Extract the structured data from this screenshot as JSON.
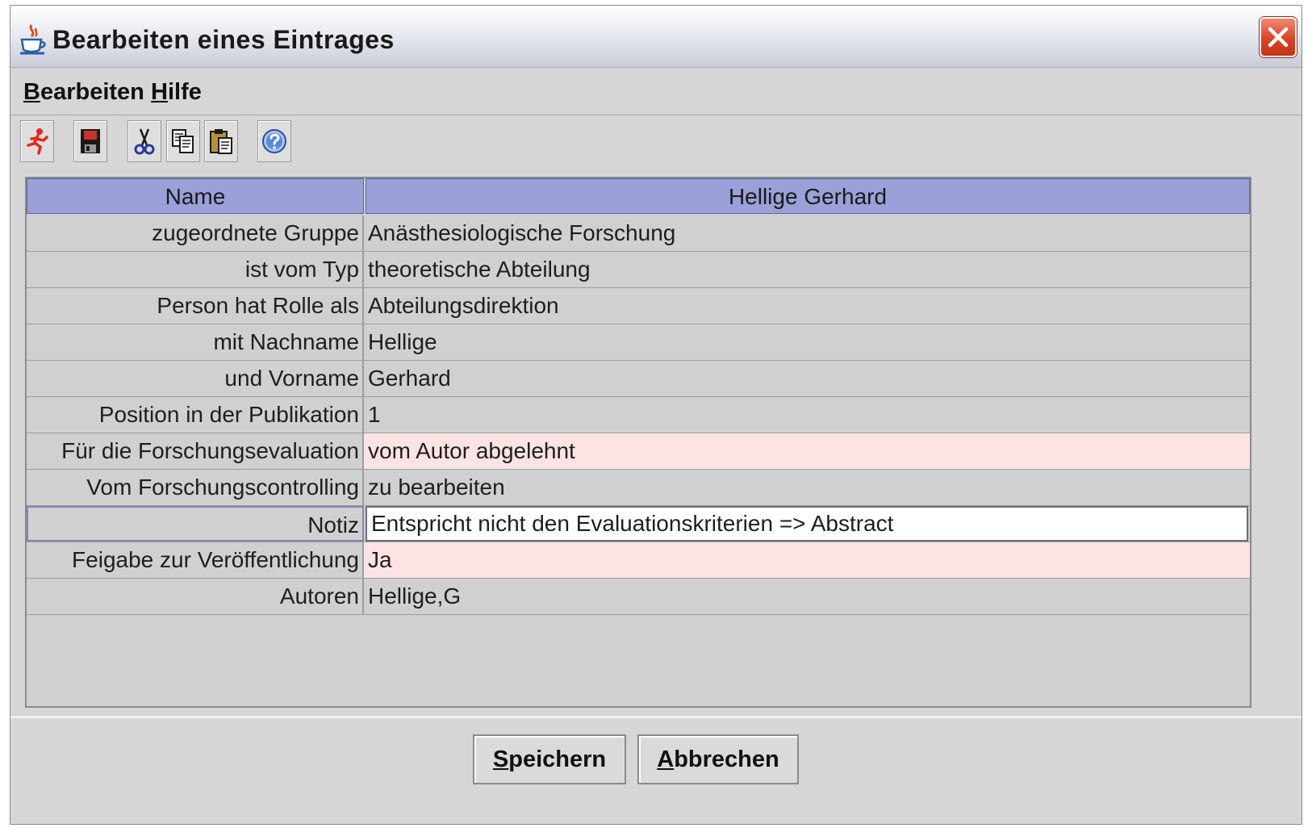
{
  "window": {
    "title": "Bearbeiten eines Eintrages"
  },
  "menu": [
    {
      "mnemonic": "B",
      "rest": "earbeiten"
    },
    {
      "mnemonic": "H",
      "rest": "ilfe"
    }
  ],
  "toolbar_icons": [
    "exit-icon",
    "save-icon",
    "cut-icon",
    "copy-icon",
    "paste-icon",
    "help-icon"
  ],
  "table": {
    "header": {
      "left": "Name",
      "right": "Hellige Gerhard"
    },
    "rows": [
      {
        "label": "zugeordnete Gruppe",
        "value": "Anästhesiologische Forschung",
        "highlight": false
      },
      {
        "label": "ist vom Typ",
        "value": "theoretische Abteilung",
        "highlight": false
      },
      {
        "label": "Person hat Rolle als",
        "value": "Abteilungsdirektion",
        "highlight": false
      },
      {
        "label": "mit Nachname",
        "value": "Hellige",
        "highlight": false
      },
      {
        "label": "und Vorname",
        "value": "Gerhard",
        "highlight": false
      },
      {
        "label": "Position in der Publikation",
        "value": "1",
        "highlight": false
      },
      {
        "label": "Für die Forschungsevaluation",
        "value": "vom Autor abgelehnt",
        "highlight": true
      },
      {
        "label": "Vom Forschungscontrolling",
        "value": "zu bearbeiten",
        "highlight": false
      },
      {
        "label": "Notiz",
        "value": "Entspricht nicht den Evaluationskriterien => Abstract",
        "highlight": false,
        "selected": true
      },
      {
        "label": "Feigabe zur Veröffentlichung",
        "value": "Ja",
        "highlight": true
      },
      {
        "label": "Autoren",
        "value": "Hellige,G",
        "highlight": false
      }
    ]
  },
  "buttons": {
    "save": {
      "mnemonic": "S",
      "rest": "peichern"
    },
    "cancel": {
      "mnemonic": "A",
      "rest": "bbrechen"
    }
  },
  "colors": {
    "header_bg": "#9aa0d8",
    "highlight_row": "#fde3e3",
    "close_button": "#d84426"
  }
}
